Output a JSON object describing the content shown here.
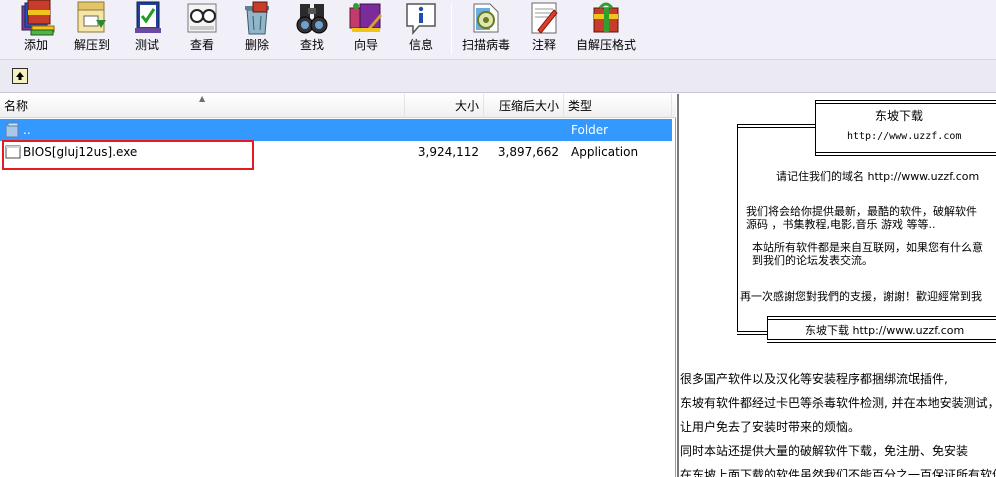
{
  "toolbar": {
    "buttons": [
      {
        "label": "添加",
        "icon": "add-archive-icon"
      },
      {
        "label": "解压到",
        "icon": "extract-to-icon"
      },
      {
        "label": "测试",
        "icon": "test-archive-icon"
      },
      {
        "label": "查看",
        "icon": "view-icon"
      },
      {
        "label": "删除",
        "icon": "delete-icon"
      },
      {
        "label": "查找",
        "icon": "find-icon"
      },
      {
        "label": "向导",
        "icon": "wizard-icon"
      },
      {
        "label": "信息",
        "icon": "info-icon"
      },
      {
        "label": "扫描病毒",
        "icon": "virus-scan-icon"
      },
      {
        "label": "注释",
        "icon": "comment-icon"
      },
      {
        "label": "自解压格式",
        "icon": "sfx-icon"
      }
    ]
  },
  "columns": {
    "name": "名称",
    "size": "大小",
    "packed": "压缩后大小",
    "type": "类型"
  },
  "files": [
    {
      "name": "..",
      "size": "",
      "packed": "",
      "type": "Folder",
      "icon": "folder-icon",
      "selected": true
    },
    {
      "name": "BIOS[gluj12us].exe",
      "size": "3,924,112",
      "packed": "3,897,662",
      "type": "Application",
      "icon": "file-icon",
      "selected": false
    }
  ],
  "preview": {
    "banner_title": "东坡下载",
    "banner_url": "http://www.uzzf.com",
    "remember": "请记住我们的域名 http://www.uzzf.com",
    "offer_line1": "我们将会给你提供最新，最酷的软件，破解软件",
    "offer_line2": "源码 ，书集教程,电影,音乐  游戏  等等..",
    "source_line1": "本站所有软件都是来自互联网，如果您有什么意",
    "source_line2": "到我们的论坛发表交流。",
    "thanks": "再一次感謝您對我們的支援，謝謝！歡迎經常到我",
    "footer_banner": "东坡下载 http://www.uzzf.com",
    "notes": [
      "很多国产软件以及汉化等安装程序都捆绑流氓插件,",
      "东坡有软件都经过卡巴等杀毒软件检测, 并在本地安装测试，",
      "让用户免去了安装时带来的烦恼。",
      "同时本站还提供大量的破解软件下载，免注册、免安装",
      "在东坡上面下载的软件虽然我们不能百分之一百保证所有软件"
    ]
  },
  "colors": {
    "selection": "#3399ff",
    "highlight_box": "#e41b23",
    "toolbar_bg": "#f1f0f8"
  }
}
